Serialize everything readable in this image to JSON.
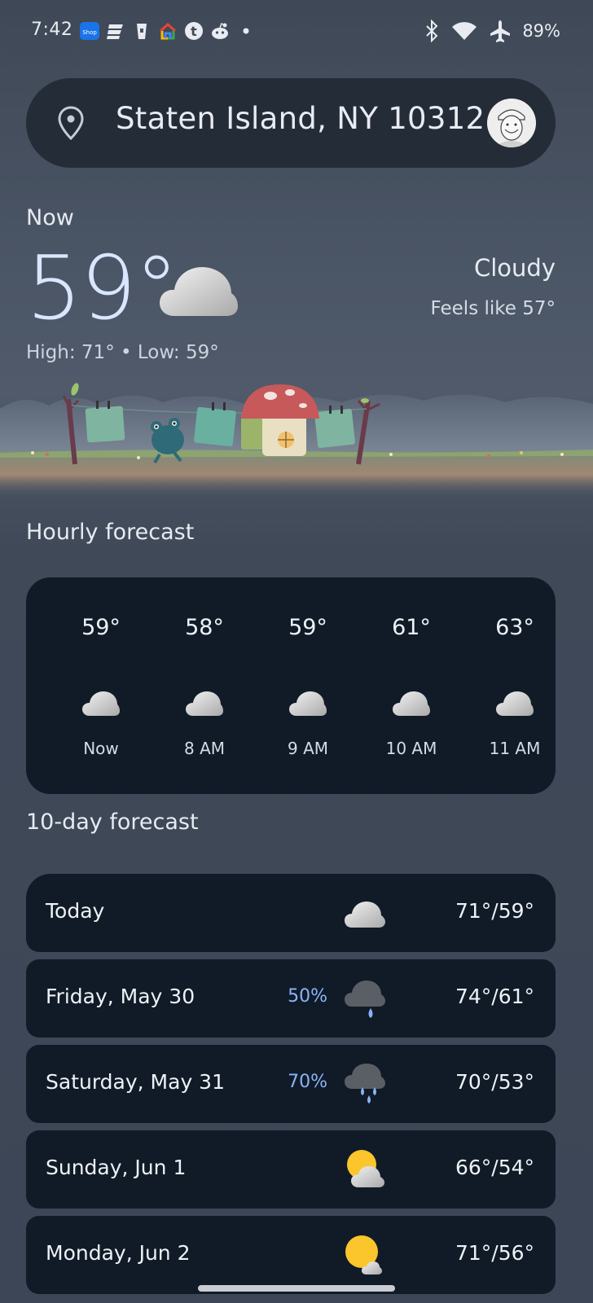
{
  "status_bar": {
    "time": "7:42",
    "notification_icons": [
      "shop-icon",
      "news-icon",
      "cup-icon",
      "google-home-icon",
      "tumblr-icon",
      "reddit-icon",
      "dot-icon"
    ],
    "shop_label": "Shop",
    "battery": "89%"
  },
  "location": {
    "text": "Staten Island, NY 10312"
  },
  "current": {
    "label": "Now",
    "temp": "59°",
    "condition": "Cloudy",
    "feels_like": "Feels like 57°",
    "high_low": "High: 71° • Low: 59°"
  },
  "hourly": {
    "title": "Hourly forecast",
    "items": [
      {
        "temp": "59°",
        "time": "Now",
        "icon": "cloud-icon"
      },
      {
        "temp": "58°",
        "time": "8 AM",
        "icon": "cloud-icon"
      },
      {
        "temp": "59°",
        "time": "9 AM",
        "icon": "cloud-icon"
      },
      {
        "temp": "61°",
        "time": "10 AM",
        "icon": "cloud-icon"
      },
      {
        "temp": "63°",
        "time": "11 AM",
        "icon": "cloud-icon"
      }
    ]
  },
  "daily": {
    "title": "10-day forecast",
    "items": [
      {
        "day": "Today",
        "precip": "",
        "icon": "cloud-icon",
        "temps": "71°/59°"
      },
      {
        "day": "Friday, May 30",
        "precip": "50%",
        "icon": "rain-cloud-icon",
        "temps": "74°/61°"
      },
      {
        "day": "Saturday, May 31",
        "precip": "70%",
        "icon": "heavy-rain-cloud-icon",
        "temps": "70°/53°"
      },
      {
        "day": "Sunday, Jun 1",
        "precip": "",
        "icon": "partly-sunny-icon",
        "temps": "66°/54°"
      },
      {
        "day": "Monday, Jun 2",
        "precip": "",
        "icon": "mostly-sunny-icon",
        "temps": "71°/56°"
      }
    ]
  },
  "colors": {
    "card_bg": "#101b27",
    "precip_blue": "#8ab4f8",
    "temp_big": "#d9e6ff"
  }
}
